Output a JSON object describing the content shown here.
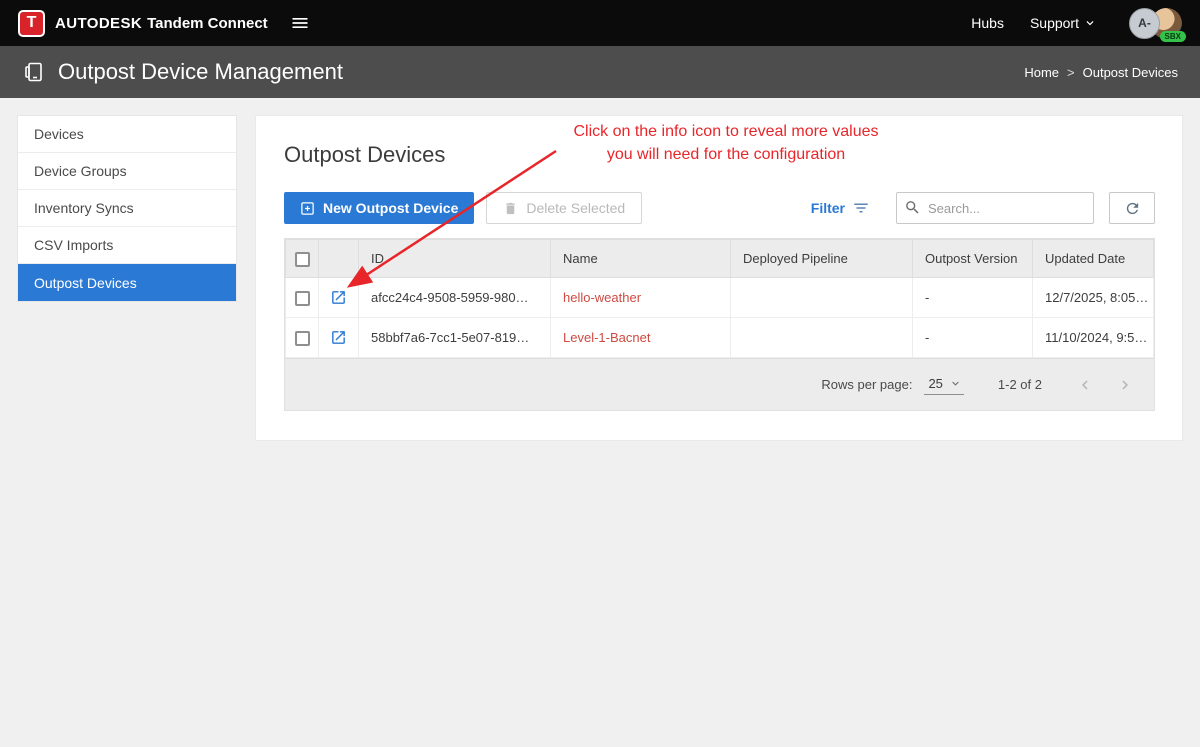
{
  "topbar": {
    "logo_letter": "T",
    "brand": "AUTODESK",
    "brand_suffix": "Tandem Connect",
    "nav": {
      "hubs": "Hubs",
      "support": "Support"
    },
    "avatar_initials": "A-",
    "env_badge": "SBX"
  },
  "header": {
    "title": "Outpost Device Management",
    "breadcrumb": {
      "home": "Home",
      "sep": ">",
      "current": "Outpost Devices"
    }
  },
  "sidebar": {
    "items": [
      {
        "label": "Devices"
      },
      {
        "label": "Device Groups"
      },
      {
        "label": "Inventory Syncs"
      },
      {
        "label": "CSV Imports"
      },
      {
        "label": "Outpost Devices"
      }
    ]
  },
  "main": {
    "title": "Outpost Devices",
    "annotation": {
      "line1": "Click on the info icon to reveal more values",
      "line2": "you will need for the configuration"
    },
    "toolbar": {
      "new_button": "New Outpost Device",
      "delete_button": "Delete Selected",
      "filter_label": "Filter",
      "search_placeholder": "Search..."
    },
    "table": {
      "headers": [
        "ID",
        "Name",
        "Deployed Pipeline",
        "Outpost Version",
        "Updated Date"
      ],
      "rows": [
        {
          "id": "afcc24c4-9508-5959-980…",
          "name": "hello-weather",
          "pipeline": "",
          "version": "-",
          "updated": "12/7/2025, 8:05…"
        },
        {
          "id": "58bbf7a6-7cc1-5e07-819…",
          "name": "Level-1-Bacnet",
          "pipeline": "",
          "version": "-",
          "updated": "11/10/2024, 9:5…"
        }
      ]
    },
    "pagination": {
      "rows_per_page_label": "Rows per page:",
      "rows_per_page_value": "25",
      "range": "1-2 of 2"
    }
  },
  "colors": {
    "accent_blue": "#2a79d4",
    "link_red": "#cf4a41",
    "annotation_red": "#e8262a",
    "badge_green": "#35c24a",
    "header_gray": "#4d4d4d",
    "topbar_black": "#0b0b0b"
  }
}
